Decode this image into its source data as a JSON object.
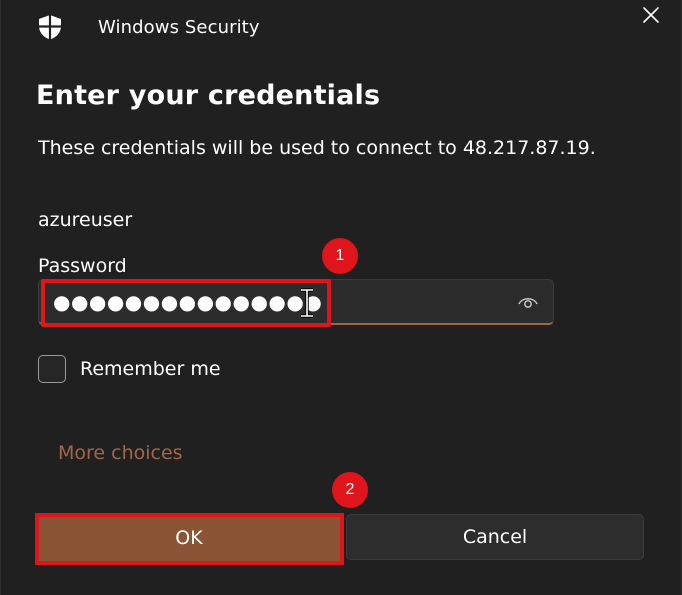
{
  "window": {
    "app_title": "Windows Security",
    "close_icon": "close-icon",
    "shield_icon": "shield-icon"
  },
  "dialog": {
    "heading": "Enter your credentials",
    "description": "These credentials will be used to connect to 48.217.87.19.",
    "username": "azureuser",
    "password_label": "Password",
    "password_masked": "●●●●●●●●●●●●●●●",
    "reveal_icon": "eye-icon",
    "remember_label": "Remember me",
    "remember_checked": false,
    "more_choices": "More choices",
    "ok_label": "OK",
    "cancel_label": "Cancel"
  },
  "annotations": {
    "badge_1": "1",
    "badge_2": "2",
    "highlight_color": "#e0151b"
  },
  "colors": {
    "background": "#202020",
    "accent": "#8b5535",
    "link": "#a0674a"
  }
}
